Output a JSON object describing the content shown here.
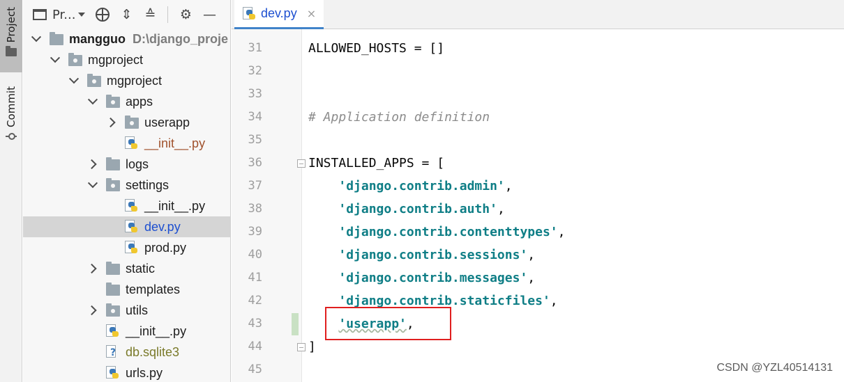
{
  "toolstrip": {
    "project_label": "Project",
    "commit_label": "Commit"
  },
  "project_panel": {
    "view_label": "Pr...",
    "tree": [
      {
        "label": "mangguo",
        "hint": "D:\\django_proje",
        "kind": "folder",
        "expanded": true,
        "bold": true
      },
      {
        "label": "mgproject",
        "kind": "folder-pkg",
        "expanded": true
      },
      {
        "label": "mgproject",
        "kind": "folder-pkg",
        "expanded": true
      },
      {
        "label": "apps",
        "kind": "folder-pkg",
        "expanded": true
      },
      {
        "label": "userapp",
        "kind": "folder-pkg",
        "expanded": false
      },
      {
        "label": "__init__.py",
        "kind": "py",
        "color": "orange"
      },
      {
        "label": "logs",
        "kind": "folder",
        "expanded": false
      },
      {
        "label": "settings",
        "kind": "folder-pkg",
        "expanded": true
      },
      {
        "label": "__init__.py",
        "kind": "py"
      },
      {
        "label": "dev.py",
        "kind": "py",
        "selected": true,
        "color": "blue"
      },
      {
        "label": "prod.py",
        "kind": "py"
      },
      {
        "label": "static",
        "kind": "folder",
        "expanded": false
      },
      {
        "label": "templates",
        "kind": "folder"
      },
      {
        "label": "utils",
        "kind": "folder-pkg",
        "expanded": false
      },
      {
        "label": "__init__.py",
        "kind": "py"
      },
      {
        "label": "db.sqlite3",
        "kind": "db",
        "color": "olive"
      },
      {
        "label": "urls.py",
        "kind": "py"
      }
    ]
  },
  "editor": {
    "tab": {
      "label": "dev.py",
      "close": "×"
    },
    "lines": [
      {
        "num": "31",
        "parts": [
          {
            "t": "ALLOWED_HOSTS = []",
            "c": ""
          }
        ]
      },
      {
        "num": "32",
        "parts": []
      },
      {
        "num": "33",
        "parts": []
      },
      {
        "num": "34",
        "parts": [
          {
            "t": "# Application definition",
            "c": "comment"
          }
        ]
      },
      {
        "num": "35",
        "parts": []
      },
      {
        "num": "36",
        "parts": [
          {
            "t": "INSTALLED_APPS = [",
            "c": ""
          }
        ]
      },
      {
        "num": "37",
        "parts": [
          {
            "t": "    ",
            "c": ""
          },
          {
            "t": "'django.contrib.admin'",
            "c": "str"
          },
          {
            "t": ",",
            "c": ""
          }
        ]
      },
      {
        "num": "38",
        "parts": [
          {
            "t": "    ",
            "c": ""
          },
          {
            "t": "'django.contrib.auth'",
            "c": "str"
          },
          {
            "t": ",",
            "c": ""
          }
        ]
      },
      {
        "num": "39",
        "parts": [
          {
            "t": "    ",
            "c": ""
          },
          {
            "t": "'django.contrib.contenttypes'",
            "c": "str"
          },
          {
            "t": ",",
            "c": ""
          }
        ]
      },
      {
        "num": "40",
        "parts": [
          {
            "t": "    ",
            "c": ""
          },
          {
            "t": "'django.contrib.sessions'",
            "c": "str"
          },
          {
            "t": ",",
            "c": ""
          }
        ]
      },
      {
        "num": "41",
        "parts": [
          {
            "t": "    ",
            "c": ""
          },
          {
            "t": "'django.contrib.messages'",
            "c": "str"
          },
          {
            "t": ",",
            "c": ""
          }
        ]
      },
      {
        "num": "42",
        "parts": [
          {
            "t": "    ",
            "c": ""
          },
          {
            "t": "'django.contrib.staticfiles'",
            "c": "str"
          },
          {
            "t": ",",
            "c": ""
          }
        ]
      },
      {
        "num": "43",
        "parts": [
          {
            "t": "    ",
            "c": ""
          },
          {
            "t": "'userapp'",
            "c": "str-warn"
          },
          {
            "t": ",",
            "c": ""
          }
        ]
      },
      {
        "num": "44",
        "parts": [
          {
            "t": "]",
            "c": ""
          }
        ]
      },
      {
        "num": "45",
        "parts": []
      }
    ]
  },
  "watermark": "CSDN @YZL40514131",
  "colors": {
    "string": "#0f7e86",
    "comment": "#8c8c8c",
    "highlight_box": "#e01f1f",
    "selection": "#d5d5d5",
    "tab_underline": "#4083c9"
  }
}
